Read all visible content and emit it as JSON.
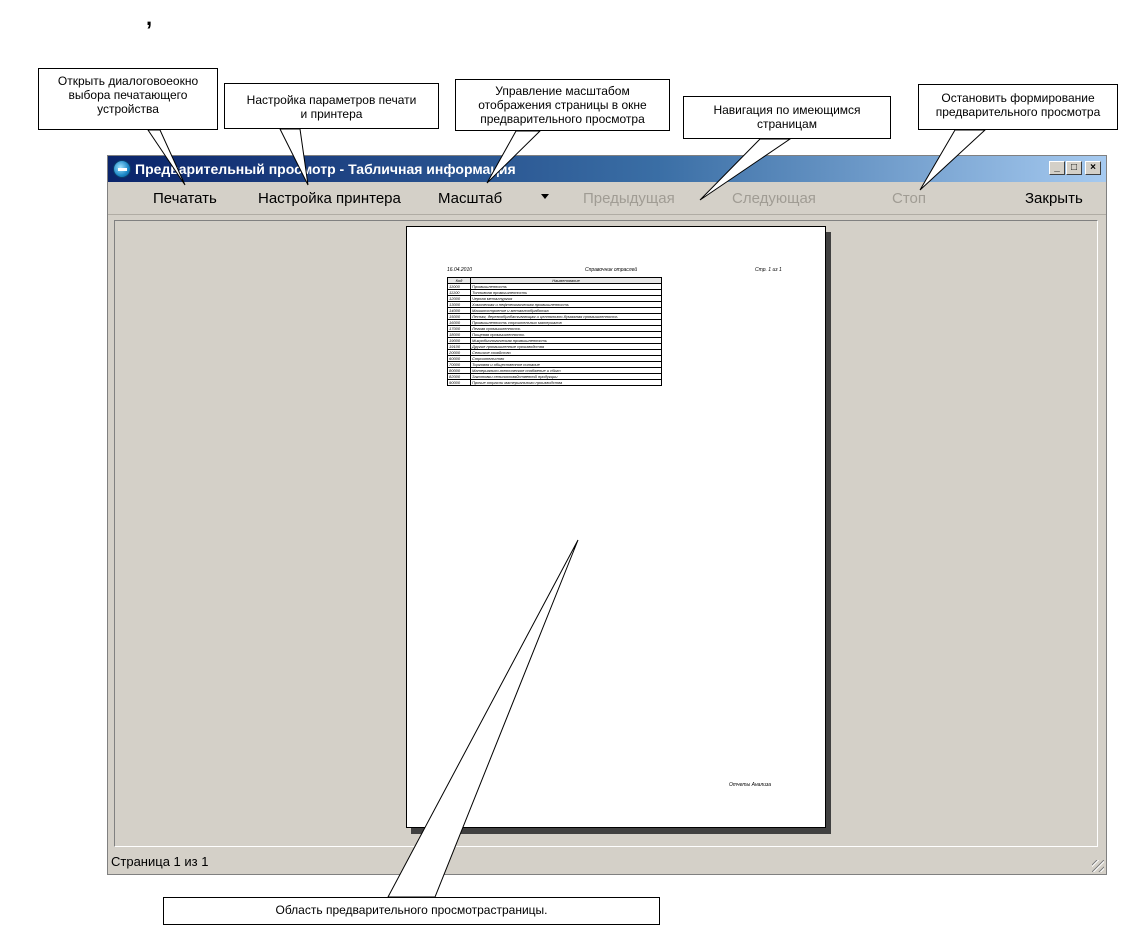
{
  "stray_mark": ",",
  "callouts": {
    "open_dialog": "Открыть диалоговоеокно\nвыбора печатающего\nустройства",
    "printer_settings": "Настройка параметров печати\nи принтера",
    "zoom_control": "Управление масштабом\nотображения страницы в окне\nпредварительного просмотра",
    "navigation": "Навигация по имеющимся\nстраницам",
    "stop_preview": "Остановить формирование\nпредварительного просмотра",
    "preview_area": "Область предварительного просмотрастраницы."
  },
  "window": {
    "title": "Предварительный просмотр - Табличная информация",
    "minimize": "_",
    "maximize": "□",
    "close": "×"
  },
  "toolbar": {
    "print": "Печатать",
    "printer_setup": "Настройка принтера",
    "zoom": "Масштаб",
    "previous": "Предыдущая",
    "next": "Следующая",
    "stop": "Стоп",
    "close": "Закрыть"
  },
  "page": {
    "header_left": "16.04.2010",
    "header_center": "Справочник отраслей",
    "header_right": "Стр. 1 из 1",
    "table_headers": [
      "Код",
      "Наименование"
    ],
    "table_rows": [
      [
        "11000",
        "Промышленность"
      ],
      [
        "11100",
        "Топливная промышленность"
      ],
      [
        "12000",
        "Черная металлургия"
      ],
      [
        "13000",
        "Химическая и нефтехимическая промышленность"
      ],
      [
        "14000",
        "Машиностроение и металлообработка"
      ],
      [
        "15000",
        "Лесная, деревообрабатывающая и целлюлозно-бумажная промышленность"
      ],
      [
        "16000",
        "Промышленность строительных материалов"
      ],
      [
        "17000",
        "Легкая промышленность"
      ],
      [
        "18000",
        "Пищевая промышленность"
      ],
      [
        "19000",
        "Микробиологическая промышленность"
      ],
      [
        "19100",
        "Другие промышленные производства"
      ],
      [
        "20000",
        "Сельское хозяйство"
      ],
      [
        "60000",
        "Строительство"
      ],
      [
        "70000",
        "Торговля и общественное питание"
      ],
      [
        "80000",
        "Материально-техническое снабжение и сбыт"
      ],
      [
        "82000",
        "Заготовки сельскохозяйственной продукции"
      ],
      [
        "90000",
        "Прочие отрасли материального производства"
      ]
    ],
    "footer_right": "Отчеты Анализа"
  },
  "status": {
    "page_info": "Страница 1 из 1"
  }
}
